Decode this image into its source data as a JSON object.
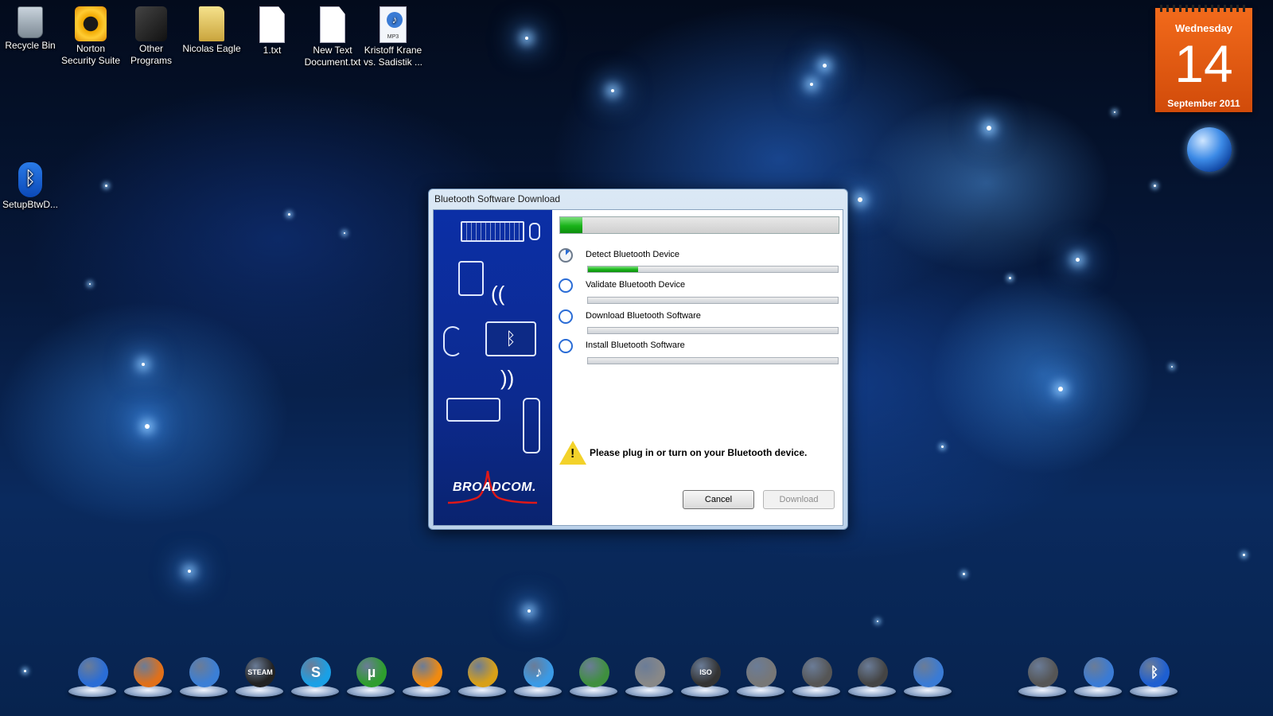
{
  "desktop": {
    "icons": [
      {
        "label": "Recycle Bin",
        "icon": "recycle-bin-icon"
      },
      {
        "label": "Norton\nSecurity Suite",
        "icon": "norton-icon"
      },
      {
        "label": "Other\nPrograms",
        "icon": "windows-folder-icon"
      },
      {
        "label": "Nicolas Eagle",
        "icon": "folder-icon"
      },
      {
        "label": "1.txt",
        "icon": "text-file-icon"
      },
      {
        "label": "New Text\nDocument.txt",
        "icon": "text-file-icon"
      },
      {
        "label": "Kristoff Krane\nvs. Sadistik ...",
        "icon": "mp3-file-icon"
      },
      {
        "label": "SetupBtwD...",
        "icon": "bluetooth-setup-icon"
      }
    ],
    "mp3_badge": "MP3"
  },
  "calendar": {
    "weekday": "Wednesday",
    "day": "14",
    "month_year": "September 2011"
  },
  "dialog": {
    "title": "Bluetooth Software Download",
    "overall_progress": 0.08,
    "brand": "BROADCOM.",
    "steps": [
      {
        "label": "Detect Bluetooth Device",
        "status": "in-progress",
        "progress": 0.2
      },
      {
        "label": "Validate Bluetooth Device",
        "status": "pending",
        "progress": 0
      },
      {
        "label": "Download Bluetooth Software",
        "status": "pending",
        "progress": 0
      },
      {
        "label": "Install Bluetooth Software",
        "status": "pending",
        "progress": 0
      }
    ],
    "message": "Please plug in or turn on your Bluetooth device.",
    "buttons": {
      "cancel": "Cancel",
      "download": "Download"
    }
  },
  "dock": {
    "items": [
      {
        "name": "windows-start-icon"
      },
      {
        "name": "firefox-icon"
      },
      {
        "name": "network-globe-icon"
      },
      {
        "name": "steam-icon",
        "label": "STEAM"
      },
      {
        "name": "skype-icon",
        "label": "S"
      },
      {
        "name": "utorrent-icon",
        "label": "µ"
      },
      {
        "name": "vlc-icon"
      },
      {
        "name": "nero-disc-icon"
      },
      {
        "name": "itunes-icon",
        "label": "♪"
      },
      {
        "name": "hardware-tools-icon"
      },
      {
        "name": "gamepad-icon"
      },
      {
        "name": "iso-disc-icon",
        "label": "ISO"
      },
      {
        "name": "game-tools-icon"
      },
      {
        "name": "camera-icon"
      },
      {
        "name": "video-camera-icon"
      },
      {
        "name": "photo-camera-icon"
      },
      {
        "name": "remote-desktop-icon"
      },
      {
        "name": "document-icon"
      },
      {
        "name": "bluetooth-icon",
        "label": "ᛒ"
      }
    ]
  },
  "colors": {
    "progress_green": "#19b319",
    "calendar_orange": "#e8580f",
    "sidebar_blue": "#0c2a8f"
  }
}
